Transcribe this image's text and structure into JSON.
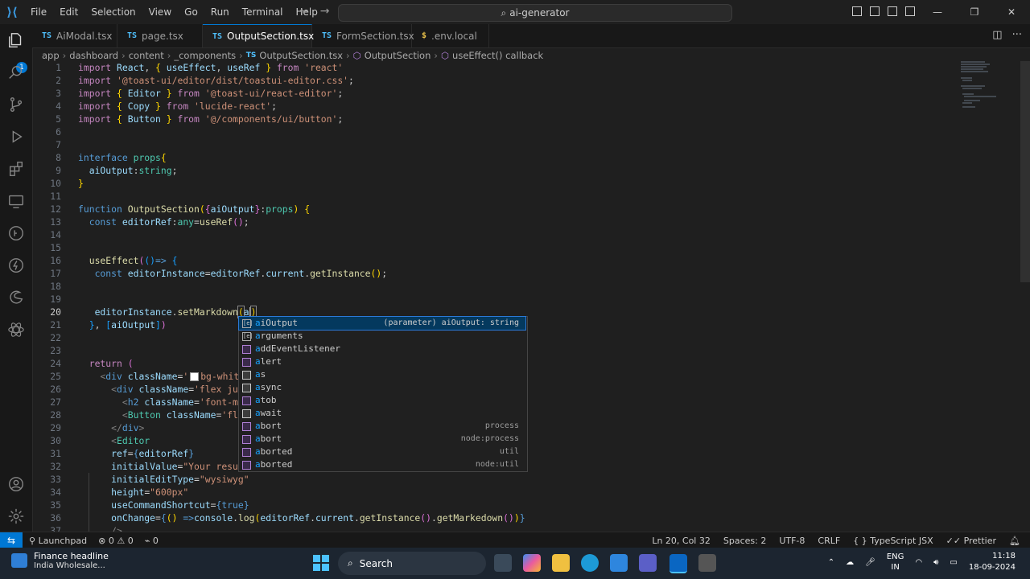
{
  "titlebar": {
    "menu": [
      "File",
      "Edit",
      "Selection",
      "View",
      "Go",
      "Run",
      "Terminal",
      "Help"
    ],
    "command_center": "ai-generator"
  },
  "tabs": [
    {
      "icon": "TS",
      "label": "AiModal.tsx",
      "active": false
    },
    {
      "icon": "TS",
      "label": "page.tsx",
      "active": false
    },
    {
      "icon": "TS",
      "label": "OutputSection.tsx",
      "active": true,
      "modified": true
    },
    {
      "icon": "TS",
      "label": "FormSection.tsx",
      "active": false
    },
    {
      "icon": "$",
      "label": ".env.local",
      "active": false
    }
  ],
  "breadcrumb": [
    "app",
    "dashboard",
    "content",
    "_components",
    "OutputSection.tsx",
    "OutputSection",
    "useEffect() callback"
  ],
  "activity_badge": "1",
  "line_numbers": [
    "1",
    "2",
    "3",
    "4",
    "5",
    "6",
    "7",
    "8",
    "9",
    "10",
    "11",
    "12",
    "13",
    "14",
    "15",
    "16",
    "17",
    "18",
    "19",
    "20",
    "21",
    "22",
    "23",
    "24",
    "25",
    "26",
    "27",
    "28",
    "29",
    "30",
    "31",
    "32",
    "33",
    "34",
    "35",
    "36",
    "37"
  ],
  "code": {
    "l1": [
      "import",
      " ",
      "React",
      ", ",
      "{",
      " ",
      "useEffect",
      ", ",
      "useRef",
      " ",
      "}",
      " ",
      "from",
      " ",
      "'react'"
    ],
    "l2": [
      "import",
      " ",
      "'@toast-ui/editor/dist/toastui-editor.css'",
      ";"
    ],
    "l3": [
      "import",
      " ",
      "{",
      " ",
      "Editor",
      " ",
      "}",
      " ",
      "from",
      " ",
      "'@toast-ui/react-editor'",
      ";"
    ],
    "l4": [
      "import",
      " ",
      "{",
      " ",
      "Copy",
      " ",
      "}",
      " ",
      "from",
      " ",
      "'lucide-react'",
      ";"
    ],
    "l5": [
      "import",
      " ",
      "{",
      " ",
      "Button",
      " ",
      "}",
      " ",
      "from",
      " ",
      "'@/components/ui/button'",
      ";"
    ],
    "l8": [
      "interface",
      " ",
      "props",
      "{"
    ],
    "l9": [
      "aiOutput",
      ":",
      "string",
      ";"
    ],
    "l10": [
      "}"
    ],
    "l12": [
      "function",
      " ",
      "OutputSection",
      "(",
      "{",
      "aiOutput",
      "}",
      ":",
      "props",
      ")",
      " ",
      "{"
    ],
    "l13": [
      "const",
      " ",
      "editorRef",
      ":",
      "any",
      "=",
      "useRef",
      "(",
      ")",
      ";"
    ],
    "l16": [
      "useEffect",
      "(",
      "(",
      ")",
      "=>",
      " ",
      "{"
    ],
    "l17": [
      "const",
      " ",
      "editorInstance",
      "=",
      "editorRef",
      ".",
      "current",
      ".",
      "getInstance",
      "(",
      ")",
      ";"
    ],
    "l20": [
      "editorInstance",
      ".",
      "setMarkdown",
      "(",
      "a",
      ")"
    ],
    "l21": [
      "}",
      ", ",
      "[",
      "aiOutput",
      "]",
      ")"
    ],
    "l24": [
      "return",
      " ",
      "("
    ],
    "l25": [
      "<",
      "div",
      " ",
      "className",
      "=",
      "'",
      "bg-white"
    ],
    "l26": [
      "<",
      "div",
      " ",
      "className",
      "=",
      "'flex just"
    ],
    "l27": [
      "<",
      "h2",
      " ",
      "className",
      "=",
      "'font-med"
    ],
    "l28": [
      "<",
      "Button",
      " ",
      "className",
      "=",
      "'flex"
    ],
    "l29": [
      "</",
      "div",
      ">"
    ],
    "l30": [
      "<",
      "Editor"
    ],
    "l31": [
      "ref",
      "=",
      "{",
      "editorRef",
      "}"
    ],
    "l32": [
      "initialValue",
      "=",
      "\"Your result"
    ],
    "l33": [
      "initialEditType",
      "=",
      "\"wysiwyg\""
    ],
    "l34": [
      "height",
      "=",
      "\"600px\""
    ],
    "l35": [
      "useCommandShortcut",
      "=",
      "{",
      "true",
      "}"
    ],
    "l36": [
      "onChange",
      "=",
      "{",
      "(",
      ")",
      " ",
      "=>",
      "console",
      ".",
      "log",
      "(",
      "editorRef",
      ".",
      "current",
      ".",
      "getInstance",
      "(",
      ")",
      ".",
      "getMarkedown",
      "(",
      ")",
      ")",
      "}"
    ],
    "l37": [
      "/>"
    ]
  },
  "suggest": [
    {
      "kind": "var",
      "label": "aiOutput",
      "detail": "(parameter) aiOutput: string"
    },
    {
      "kind": "var",
      "label": "arguments",
      "detail": ""
    },
    {
      "kind": "cube",
      "label": "addEventListener",
      "detail": ""
    },
    {
      "kind": "cube",
      "label": "alert",
      "detail": ""
    },
    {
      "kind": "kw",
      "label": "as",
      "detail": ""
    },
    {
      "kind": "kw",
      "label": "async",
      "detail": ""
    },
    {
      "kind": "cube",
      "label": "atob",
      "detail": ""
    },
    {
      "kind": "kw",
      "label": "await",
      "detail": ""
    },
    {
      "kind": "cube",
      "label": "abort",
      "detail": "process"
    },
    {
      "kind": "cube",
      "label": "abort",
      "detail": "node:process"
    },
    {
      "kind": "cube",
      "label": "aborted",
      "detail": "util"
    },
    {
      "kind": "cube",
      "label": "aborted",
      "detail": "node:util"
    }
  ],
  "status": {
    "launchpad": "Launchpad",
    "errors": "0",
    "warnings": "0",
    "ports": "0",
    "position": "Ln 20, Col 32",
    "spaces": "Spaces: 2",
    "encoding": "UTF-8",
    "eol": "CRLF",
    "language": "TypeScript JSX",
    "prettier": "Prettier"
  },
  "taskbar": {
    "weather_title": "Finance headline",
    "weather_sub": "India Wholesale...",
    "search": "Search",
    "lang1": "ENG",
    "lang2": "IN",
    "time": "11:18",
    "date": "18-09-2024"
  }
}
